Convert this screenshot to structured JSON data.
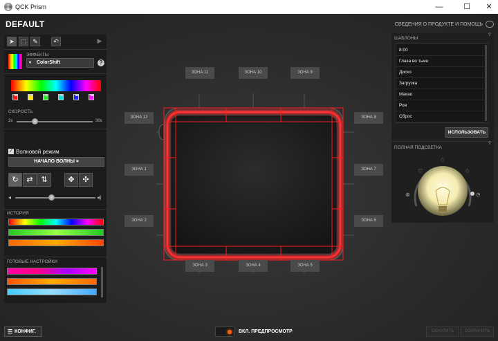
{
  "window": {
    "title": "QCK Prism",
    "minimize": "—",
    "maximize": "☐",
    "close": "✕"
  },
  "header": {
    "profile_name": "DEFAULT",
    "product_info": "СВЕДЕНИЯ О ПРОДУКТЕ И ПОМОЩЬ"
  },
  "effects": {
    "label": "ЭФФЕКТЫ",
    "selected": "ColorShift",
    "help": "?",
    "dropdown_arrow": "▾"
  },
  "color_stops": [
    "#ff1111",
    "#ffee00",
    "#22ee22",
    "#11dddd",
    "#2222ff",
    "#ff11ff"
  ],
  "speed": {
    "label": "СКОРОСТЬ",
    "min": "2s",
    "max": "30s",
    "value_fraction": 0.24
  },
  "wave": {
    "checkbox_label": "Волновой режим",
    "checked": true,
    "start_button": "НАЧАЛО ВОЛНЫ"
  },
  "volume": {
    "value_fraction": 0.45
  },
  "history": {
    "label": "ИСТОРИЯ"
  },
  "presets": {
    "label": "ГОТОВЫЕ НАСТРОЙКИ"
  },
  "zones": {
    "z1": "ЗОНА 1",
    "z2": "ЗОНА 2",
    "z3": "ЗОНА 3",
    "z4": "ЗОНА 4",
    "z5": "ЗОНА 5",
    "z6": "ЗОНА 6",
    "z7": "ЗОНА 7",
    "z8": "ЗОНА 8",
    "z9": "ЗОНА 9",
    "z10": "ЗОНА 10",
    "z11": "ЗОНА 11",
    "z12": "ЗОНА 12"
  },
  "templates": {
    "label": "ШАБЛОНЫ",
    "items": [
      "8:00",
      "Глаза во тьме",
      "Диско",
      "Загрузка",
      "Макао",
      "Ров",
      "Сброс"
    ],
    "use_button": "ИСПОЛЬЗОВАТЬ"
  },
  "full_backlight": {
    "label": "ПОЛНАЯ ПОДСВЕТКА"
  },
  "footer": {
    "config_button": "КОНФИГ.",
    "preview_label": "ВКЛ. ПРЕДПРОСМОТР",
    "reset_button": "ОБНУЛИТЬ",
    "save_button": "СОХРАНИТЬ"
  },
  "accent_color": "#ff1a1a"
}
